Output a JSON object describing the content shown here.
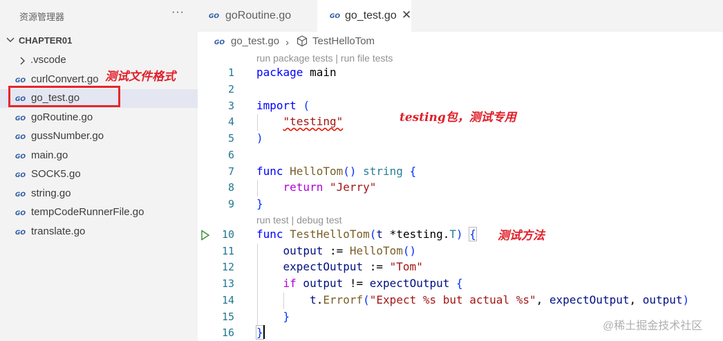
{
  "explorer": {
    "title": "资源管理器",
    "more": "···",
    "folder": "CHAPTER01",
    "items": [
      {
        "label": ".vscode",
        "kind": "folder"
      },
      {
        "label": "curlConvert.go",
        "kind": "go"
      },
      {
        "label": "go_test.go",
        "kind": "go",
        "selected": true
      },
      {
        "label": "goRoutine.go",
        "kind": "go"
      },
      {
        "label": "gussNumber.go",
        "kind": "go"
      },
      {
        "label": "main.go",
        "kind": "go"
      },
      {
        "label": "SOCK5.go",
        "kind": "go"
      },
      {
        "label": "string.go",
        "kind": "go"
      },
      {
        "label": "tempCodeRunnerFile.go",
        "kind": "go"
      },
      {
        "label": "translate.go",
        "kind": "go"
      }
    ]
  },
  "tabs": [
    {
      "label": "goRoutine.go",
      "active": false
    },
    {
      "label": "go_test.go",
      "active": true,
      "close": "✕"
    }
  ],
  "breadcrumb": {
    "file": "go_test.go",
    "separator": "›",
    "symbol": "TestHelloTom"
  },
  "codelens": {
    "package": "run package tests | run file tests",
    "test": "run test | debug test"
  },
  "line_numbers": [
    "1",
    "2",
    "3",
    "4",
    "5",
    "6",
    "7",
    "8",
    "9",
    "10",
    "11",
    "12",
    "13",
    "14",
    "15",
    "16"
  ],
  "code": {
    "l1_kw": "package",
    "l1_name": " main",
    "l3_kw": "import",
    "l3_paren": " (",
    "l4_str": "\"testing\"",
    "l5_paren": ")",
    "l7_kw": "func",
    "l7_fn": " HelloTom",
    "l7_parens": "()",
    "l7_type": " string",
    "l7_brace": " {",
    "l8_kw": "return",
    "l8_str": " \"Jerry\"",
    "l9_brace": "}",
    "l10_kw": "func",
    "l10_fn": " TestHelloTom",
    "l10_open": "(",
    "l10_param": "t",
    "l10_ptr": " *testing.",
    "l10_type": "T",
    "l10_close": ")",
    "l10_brace": "{",
    "l11_var": "output",
    "l11_op": " := ",
    "l11_fn": "HelloTom",
    "l11_parens": "()",
    "l12_var": "expectOutput",
    "l12_op": " := ",
    "l12_str": "\"Tom\"",
    "l13_kw": "if",
    "l13_var1": " output",
    "l13_op": " != ",
    "l13_var2": "expectOutput",
    "l13_brace": " {",
    "l14_var": "t",
    "l14_dot": ".",
    "l14_fn": "Errorf",
    "l14_open": "(",
    "l14_str": "\"Expect %s but actual %s\"",
    "l14_comma": ", ",
    "l14_arg1": "expectOutput",
    "l14_comma2": ", ",
    "l14_arg2": "output",
    "l14_close": ")",
    "l15_brace": "}",
    "l16_brace": "}"
  },
  "annotations": {
    "test_file_format": "测试文件格式",
    "testing_pkg": "testing包，测试专用",
    "test_method": "测试方法"
  },
  "watermark": "@稀土掘金技术社区",
  "colors": {
    "annotation_red": "#e0202a",
    "go_icon": "#2b5aa5",
    "sidebar_bg": "#f3f3f3"
  }
}
